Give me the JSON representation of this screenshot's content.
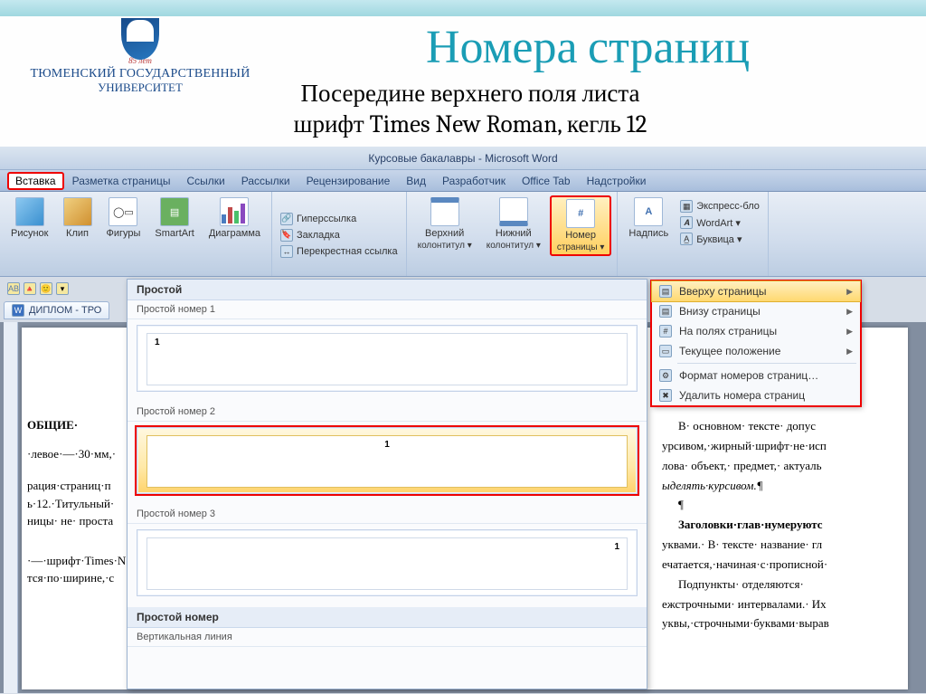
{
  "slide": {
    "title": "Номера страниц",
    "sub1": "Посередине верхнего поля листа",
    "sub2": "шрифт Times New Roman, кегль 12",
    "logo_ribbon": "85 лет",
    "logo_line1": "ТЮМЕНСКИЙ ГОСУДАРСТВЕННЫЙ",
    "logo_line2": "УНИВЕРСИТЕТ"
  },
  "word": {
    "title": "Курсовые бакалавры - Microsoft Word",
    "menu": {
      "insert": "Вставка",
      "layout": "Разметка страницы",
      "refs": "Ссылки",
      "mail": "Рассылки",
      "review": "Рецензирование",
      "view": "Вид",
      "dev": "Разработчик",
      "officetab": "Office Tab",
      "addins": "Надстройки"
    },
    "doc_tab": "ДИПЛОМ - ТРО"
  },
  "ribbon": {
    "picture": "Рисунок",
    "clip": "Клип",
    "shapes": "Фигуры",
    "smartart": "SmartArt",
    "chart": "Диаграмма",
    "hyperlink": "Гиперссылка",
    "bookmark": "Закладка",
    "crossref": "Перекрестная ссылка",
    "header": "Верхний",
    "header2": "колонтитул ▾",
    "footer": "Нижний",
    "footer2": "колонтитул ▾",
    "pagenum": "Номер",
    "pagenum2": "страницы ▾",
    "textbox": "Надпись",
    "quickparts": "Экспресс-бло",
    "wordart": "WordArt ▾",
    "dropcap": "Буквица ▾"
  },
  "gallery": {
    "header": "Простой",
    "i1": "Простой номер 1",
    "i2": "Простой номер 2",
    "i3": "Простой номер 3",
    "h2": "Простой номер",
    "i4": "Вертикальная линия"
  },
  "dropdown": {
    "top": "Вверху страницы",
    "bottom": "Внизу страницы",
    "margins": "На полях страницы",
    "current": "Текущее положение",
    "format": "Формат номеров страниц…",
    "remove": "Удалить номера страниц"
  },
  "doc": {
    "heading_general": "ОБЩИЕ·",
    "left_margin": "·левое·—·30·мм,·",
    "pagination": "рация·страниц·п",
    "title_line": "ь·12.·Титульный·",
    "no_num": "ницы· не· проста",
    "font_line": "·—·шрифт·Times·N",
    "width_line": "тся·по·ширине,·с",
    "r1": "В· основном· тексте· допус",
    "r2": "урсивом,·жирный·шрифт·не·исп",
    "r3": "лова· объект,· предмет,· актуаль",
    "r4": "ыделять·курсивом.¶",
    "r5": "¶",
    "r6": "Заголовки·глав·нумеруютс",
    "r7": "уквами.· В· тексте· название· гл",
    "r8": "ечатается,·начиная·с·прописной·",
    "r9": "Подпункты·    отделяются·",
    "r10": "ежстрочными· интервалами.· Их",
    "r11": "уквы,·строчными·буквами·вырав"
  }
}
